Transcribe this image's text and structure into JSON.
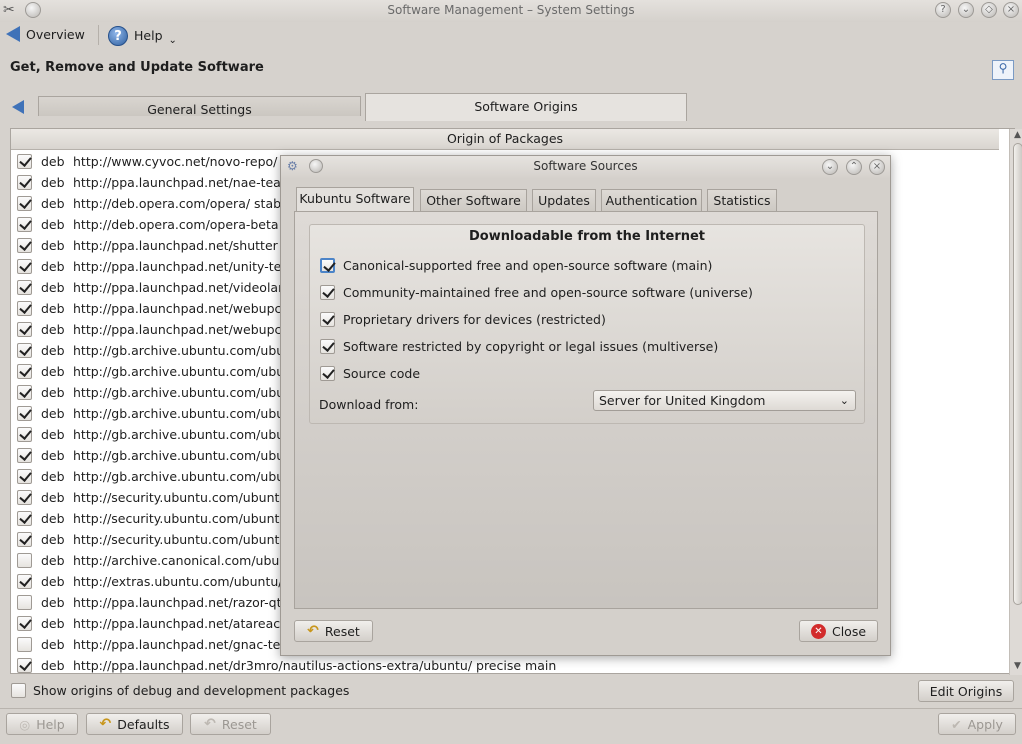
{
  "window": {
    "title": "Software Management – System Settings"
  },
  "toolbar": {
    "overview_label": "Overview",
    "help_label": "Help"
  },
  "page": {
    "title": "Get, Remove and Update Software"
  },
  "tabs": [
    {
      "label": "General Settings",
      "active": false
    },
    {
      "label": "Software Origins",
      "active": true
    }
  ],
  "table": {
    "header": "Origin of Packages",
    "rows": [
      {
        "checked": true,
        "type": "deb",
        "text": "http://www.cyvoc.net/novo-repo/ s"
      },
      {
        "checked": true,
        "type": "deb",
        "text": "http://ppa.launchpad.net/nae-tea"
      },
      {
        "checked": true,
        "type": "deb",
        "text": "http://deb.opera.com/opera/ stab"
      },
      {
        "checked": true,
        "type": "deb",
        "text": "http://deb.opera.com/opera-beta"
      },
      {
        "checked": true,
        "type": "deb",
        "text": "http://ppa.launchpad.net/shutter"
      },
      {
        "checked": true,
        "type": "deb",
        "text": "http://ppa.launchpad.net/unity-te"
      },
      {
        "checked": true,
        "type": "deb",
        "text": "http://ppa.launchpad.net/videolar"
      },
      {
        "checked": true,
        "type": "deb",
        "text": "http://ppa.launchpad.net/webupc"
      },
      {
        "checked": true,
        "type": "deb",
        "text": "http://ppa.launchpad.net/webupc"
      },
      {
        "checked": true,
        "type": "deb",
        "text": "http://gb.archive.ubuntu.com/ubu"
      },
      {
        "checked": true,
        "type": "deb",
        "text": "http://gb.archive.ubuntu.com/ubu"
      },
      {
        "checked": true,
        "type": "deb",
        "text": "http://gb.archive.ubuntu.com/ubu"
      },
      {
        "checked": true,
        "type": "deb",
        "text": "http://gb.archive.ubuntu.com/ubu"
      },
      {
        "checked": true,
        "type": "deb",
        "text": "http://gb.archive.ubuntu.com/ubu"
      },
      {
        "checked": true,
        "type": "deb",
        "text": "http://gb.archive.ubuntu.com/ubu"
      },
      {
        "checked": true,
        "type": "deb",
        "text": "http://gb.archive.ubuntu.com/ubu"
      },
      {
        "checked": true,
        "type": "deb",
        "text": "http://security.ubuntu.com/ubunt"
      },
      {
        "checked": true,
        "type": "deb",
        "text": "http://security.ubuntu.com/ubunt"
      },
      {
        "checked": true,
        "type": "deb",
        "text": "http://security.ubuntu.com/ubunt"
      },
      {
        "checked": false,
        "type": "deb",
        "text": "http://archive.canonical.com/ubur"
      },
      {
        "checked": true,
        "type": "deb",
        "text": "http://extras.ubuntu.com/ubuntu/"
      },
      {
        "checked": false,
        "type": "deb",
        "text": "http://ppa.launchpad.net/razor-qt"
      },
      {
        "checked": true,
        "type": "deb",
        "text": "http://ppa.launchpad.net/atareac"
      },
      {
        "checked": false,
        "type": "deb",
        "text": "http://ppa.launchpad.net/gnac-te"
      },
      {
        "checked": true,
        "type": "deb",
        "text": "http://ppa.launchpad.net/dr3mro/nautilus-actions-extra/ubuntu/ precise main"
      }
    ]
  },
  "bottom": {
    "debug_checkbox_label": "Show origins of debug and development packages",
    "edit_origins": "Edit Origins",
    "help": "Help",
    "defaults": "Defaults",
    "reset": "Reset",
    "apply": "Apply"
  },
  "dialog": {
    "title": "Software Sources",
    "tabs": [
      "Kubuntu Software",
      "Other Software",
      "Updates",
      "Authentication",
      "Statistics"
    ],
    "group_title": "Downloadable from the Internet",
    "options": [
      {
        "label": "Canonical-supported free and open-source software (main)",
        "checked": true
      },
      {
        "label": "Community-maintained free and open-source software (universe)",
        "checked": true
      },
      {
        "label": "Proprietary drivers for devices (restricted)",
        "checked": true
      },
      {
        "label": "Software restricted by copyright or legal issues (multiverse)",
        "checked": true
      },
      {
        "label": "Source code",
        "checked": true
      }
    ],
    "download_from_label": "Download from:",
    "download_from_value": "Server for United Kingdom",
    "reset_button": "Reset",
    "close_button": "Close"
  }
}
